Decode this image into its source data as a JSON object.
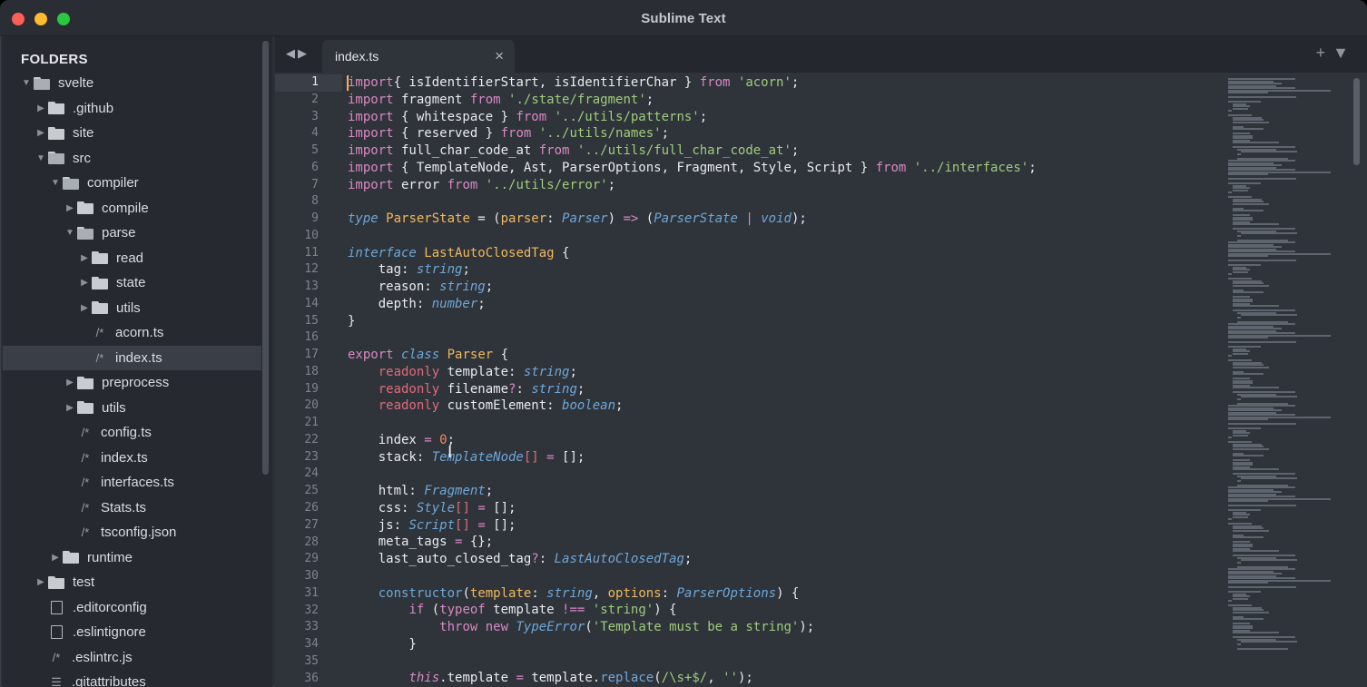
{
  "window": {
    "title": "Sublime Text"
  },
  "sidebar": {
    "heading": "FOLDERS",
    "tree": [
      {
        "label": "svelte",
        "depth": 0,
        "kind": "folder",
        "open": true
      },
      {
        "label": ".github",
        "depth": 1,
        "kind": "folder",
        "open": false
      },
      {
        "label": "site",
        "depth": 1,
        "kind": "folder",
        "open": false
      },
      {
        "label": "src",
        "depth": 1,
        "kind": "folder",
        "open": true
      },
      {
        "label": "compiler",
        "depth": 2,
        "kind": "folder",
        "open": true
      },
      {
        "label": "compile",
        "depth": 3,
        "kind": "folder",
        "open": false
      },
      {
        "label": "parse",
        "depth": 3,
        "kind": "folder",
        "open": true
      },
      {
        "label": "read",
        "depth": 4,
        "kind": "folder",
        "open": false
      },
      {
        "label": "state",
        "depth": 4,
        "kind": "folder",
        "open": false
      },
      {
        "label": "utils",
        "depth": 4,
        "kind": "folder",
        "open": false
      },
      {
        "label": "acorn.ts",
        "depth": 4,
        "kind": "code-file"
      },
      {
        "label": "index.ts",
        "depth": 4,
        "kind": "code-file",
        "selected": true
      },
      {
        "label": "preprocess",
        "depth": 3,
        "kind": "folder",
        "open": false
      },
      {
        "label": "utils",
        "depth": 3,
        "kind": "folder",
        "open": false
      },
      {
        "label": "config.ts",
        "depth": 3,
        "kind": "code-file"
      },
      {
        "label": "index.ts",
        "depth": 3,
        "kind": "code-file"
      },
      {
        "label": "interfaces.ts",
        "depth": 3,
        "kind": "code-file"
      },
      {
        "label": "Stats.ts",
        "depth": 3,
        "kind": "code-file"
      },
      {
        "label": "tsconfig.json",
        "depth": 3,
        "kind": "code-file"
      },
      {
        "label": "runtime",
        "depth": 2,
        "kind": "folder",
        "open": false
      },
      {
        "label": "test",
        "depth": 1,
        "kind": "folder",
        "open": false
      },
      {
        "label": ".editorconfig",
        "depth": 1,
        "kind": "doc-file"
      },
      {
        "label": ".eslintignore",
        "depth": 1,
        "kind": "doc-file"
      },
      {
        "label": ".eslintrc.js",
        "depth": 1,
        "kind": "code-file"
      },
      {
        "label": ".gitattributes",
        "depth": 1,
        "kind": "text-file"
      }
    ]
  },
  "tabs": [
    {
      "label": "index.ts",
      "active": true
    }
  ],
  "tab_controls": {
    "nav": "◀▶",
    "add": "+",
    "menu": "▼"
  },
  "editor": {
    "current_line": 1,
    "lines": [
      [
        [
          "kw",
          "import"
        ],
        [
          "",
          "{ isIdentifierStart, isIdentifierChar } "
        ],
        [
          "kw",
          "from"
        ],
        [
          "",
          " "
        ],
        [
          "str",
          "'acorn'"
        ],
        [
          "",
          ";"
        ]
      ],
      [
        [
          "kw",
          "import"
        ],
        [
          "",
          " fragment "
        ],
        [
          "kw",
          "from"
        ],
        [
          "",
          " "
        ],
        [
          "str",
          "'./state/fragment'"
        ],
        [
          "",
          ";"
        ]
      ],
      [
        [
          "kw",
          "import"
        ],
        [
          "",
          " { whitespace } "
        ],
        [
          "kw",
          "from"
        ],
        [
          "",
          " "
        ],
        [
          "str",
          "'../utils/patterns'"
        ],
        [
          "",
          ";"
        ]
      ],
      [
        [
          "kw",
          "import"
        ],
        [
          "",
          " { reserved } "
        ],
        [
          "kw",
          "from"
        ],
        [
          "",
          " "
        ],
        [
          "str",
          "'../utils/names'"
        ],
        [
          "",
          ";"
        ]
      ],
      [
        [
          "kw",
          "import"
        ],
        [
          "",
          " full_char_code_at "
        ],
        [
          "kw",
          "from"
        ],
        [
          "",
          " "
        ],
        [
          "str",
          "'../utils/full_char_code_at'"
        ],
        [
          "",
          ";"
        ]
      ],
      [
        [
          "kw",
          "import"
        ],
        [
          "",
          " { TemplateNode, Ast, ParserOptions, Fragment, Style, Script } "
        ],
        [
          "kw",
          "from"
        ],
        [
          "",
          " "
        ],
        [
          "str",
          "'../interfaces'"
        ],
        [
          "",
          ";"
        ]
      ],
      [
        [
          "kw",
          "import"
        ],
        [
          "",
          " error "
        ],
        [
          "kw",
          "from"
        ],
        [
          "",
          " "
        ],
        [
          "str",
          "'../utils/error'"
        ],
        [
          "",
          ";"
        ]
      ],
      [],
      [
        [
          "kw type",
          "type"
        ],
        [
          "",
          " "
        ],
        [
          "fn",
          "ParserState"
        ],
        [
          "",
          " = ("
        ],
        [
          "prm",
          "parser"
        ],
        [
          "",
          ": "
        ],
        [
          "type",
          "Parser"
        ],
        [
          "",
          ") "
        ],
        [
          "op",
          "=>"
        ],
        [
          "",
          " ("
        ],
        [
          "type",
          "ParserState"
        ],
        [
          "",
          " "
        ],
        [
          "op",
          "|"
        ],
        [
          "",
          " "
        ],
        [
          "type",
          "void"
        ],
        [
          "",
          ");"
        ]
      ],
      [],
      [
        [
          "kw type",
          "interface"
        ],
        [
          "",
          " "
        ],
        [
          "fn",
          "LastAutoClosedTag"
        ],
        [
          "",
          " {"
        ]
      ],
      [
        [
          "",
          "    tag: "
        ],
        [
          "type",
          "string"
        ],
        [
          "",
          ";"
        ]
      ],
      [
        [
          "",
          "    reason: "
        ],
        [
          "type",
          "string"
        ],
        [
          "",
          ";"
        ]
      ],
      [
        [
          "",
          "    depth: "
        ],
        [
          "type",
          "number"
        ],
        [
          "",
          ";"
        ]
      ],
      [
        [
          "",
          "}"
        ]
      ],
      [],
      [
        [
          "kw",
          "export"
        ],
        [
          "",
          " "
        ],
        [
          "kw type",
          "class"
        ],
        [
          "",
          " "
        ],
        [
          "fn",
          "Parser"
        ],
        [
          "",
          " {"
        ]
      ],
      [
        [
          "",
          "    "
        ],
        [
          "sk",
          "readonly"
        ],
        [
          "",
          " template: "
        ],
        [
          "type",
          "string"
        ],
        [
          "",
          ";"
        ]
      ],
      [
        [
          "",
          "    "
        ],
        [
          "sk",
          "readonly"
        ],
        [
          "",
          " filename"
        ],
        [
          "op",
          "?"
        ],
        [
          "",
          ": "
        ],
        [
          "type",
          "string"
        ],
        [
          "",
          ";"
        ]
      ],
      [
        [
          "",
          "    "
        ],
        [
          "sk",
          "readonly"
        ],
        [
          "",
          " customElement: "
        ],
        [
          "type",
          "boolean"
        ],
        [
          "",
          ";"
        ]
      ],
      [],
      [
        [
          "",
          "    index "
        ],
        [
          "op",
          "="
        ],
        [
          "",
          " "
        ],
        [
          "num",
          "0"
        ],
        [
          "",
          ";"
        ]
      ],
      [
        [
          "",
          "    stack: "
        ],
        [
          "type",
          "TemplateNode"
        ],
        [
          "sk",
          "[]"
        ],
        [
          "",
          " "
        ],
        [
          "op",
          "="
        ],
        [
          "",
          " [];"
        ]
      ],
      [],
      [
        [
          "",
          "    html: "
        ],
        [
          "type",
          "Fragment"
        ],
        [
          "",
          ";"
        ]
      ],
      [
        [
          "",
          "    css: "
        ],
        [
          "type",
          "Style"
        ],
        [
          "sk",
          "[]"
        ],
        [
          "",
          " "
        ],
        [
          "op",
          "="
        ],
        [
          "",
          " [];"
        ]
      ],
      [
        [
          "",
          "    js: "
        ],
        [
          "type",
          "Script"
        ],
        [
          "sk",
          "[]"
        ],
        [
          "",
          " "
        ],
        [
          "op",
          "="
        ],
        [
          "",
          " [];"
        ]
      ],
      [
        [
          "",
          "    meta_tags "
        ],
        [
          "op",
          "="
        ],
        [
          "",
          " {};"
        ]
      ],
      [
        [
          "",
          "    last_auto_closed_tag"
        ],
        [
          "op",
          "?"
        ],
        [
          "",
          ": "
        ],
        [
          "type",
          "LastAutoClosedTag"
        ],
        [
          "",
          ";"
        ]
      ],
      [],
      [
        [
          "",
          "    "
        ],
        [
          "meth",
          "constructor"
        ],
        [
          "",
          "("
        ],
        [
          "prm",
          "template"
        ],
        [
          "",
          ": "
        ],
        [
          "type",
          "string"
        ],
        [
          "",
          ", "
        ],
        [
          "prm",
          "options"
        ],
        [
          "",
          ": "
        ],
        [
          "type",
          "ParserOptions"
        ],
        [
          "",
          ") {"
        ]
      ],
      [
        [
          "",
          "        "
        ],
        [
          "kw",
          "if"
        ],
        [
          "",
          " ("
        ],
        [
          "kw",
          "typeof"
        ],
        [
          "",
          " template "
        ],
        [
          "op",
          "!=="
        ],
        [
          "",
          " "
        ],
        [
          "str",
          "'string'"
        ],
        [
          "",
          ") {"
        ]
      ],
      [
        [
          "",
          "            "
        ],
        [
          "kw",
          "throw"
        ],
        [
          "",
          " "
        ],
        [
          "kw",
          "new"
        ],
        [
          "",
          " "
        ],
        [
          "type",
          "TypeError"
        ],
        [
          "",
          "("
        ],
        [
          "str",
          "'Template must be a string'"
        ],
        [
          "",
          ");"
        ]
      ],
      [
        [
          "",
          "        }"
        ]
      ],
      [],
      [
        [
          "",
          "        "
        ],
        [
          "this",
          "this"
        ],
        [
          "",
          ".template "
        ],
        [
          "op",
          "="
        ],
        [
          "",
          " template."
        ],
        [
          "meth",
          "replace"
        ],
        [
          "",
          "("
        ],
        [
          "str",
          "/\\s+$/"
        ],
        [
          "",
          ", "
        ],
        [
          "str",
          "''"
        ],
        [
          "",
          ");"
        ]
      ]
    ]
  },
  "colors": {
    "background": "#2f333a",
    "sidebar": "#262a30",
    "keyword": "#d889c5",
    "string": "#9fcd7c",
    "type": "#6ea8d8",
    "function": "#f1b95c",
    "number": "#f28c54",
    "caret": "#f5b45a"
  }
}
